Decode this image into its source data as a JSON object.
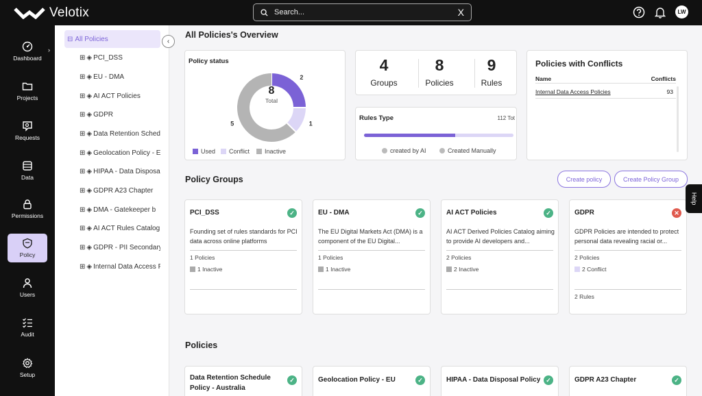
{
  "app": {
    "name": "Velotix"
  },
  "search": {
    "placeholder": "Search...",
    "clear": "X"
  },
  "user": {
    "initials": "LW"
  },
  "nav": [
    {
      "label": "Dashboard",
      "icon": "dashboard-icon"
    },
    {
      "label": "Projects",
      "icon": "folder-icon"
    },
    {
      "label": "Requests",
      "icon": "requests-icon"
    },
    {
      "label": "Data",
      "icon": "database-icon"
    },
    {
      "label": "Permissions",
      "icon": "lock-icon"
    },
    {
      "label": "Policy",
      "icon": "shield-icon",
      "active": true
    },
    {
      "label": "Users",
      "icon": "user-icon"
    },
    {
      "label": "Audit",
      "icon": "checklist-icon"
    },
    {
      "label": "Setup",
      "icon": "gear-icon"
    }
  ],
  "tree": {
    "root": "All Policies",
    "items": [
      "PCI_DSS",
      "EU - DMA",
      "AI ACT Policies",
      "GDPR",
      "Data Retention Schedule Policy - Australia",
      "Geolocation Policy - EU",
      "HIPAA - Data Disposal Policy",
      "GDPR A23 Chapter",
      "DMA - Gatekeeper b",
      "AI ACT Rules Catalog",
      "GDPR - PII Secondary",
      "Internal Data Access Policies"
    ]
  },
  "overview": {
    "title": "All Policies's Overview",
    "policy_status": {
      "title": "Policy status",
      "total": "8",
      "total_label": "Total",
      "used": 2,
      "conflict": 1,
      "inactive": 5,
      "used_label": "2",
      "conflict_label": "1",
      "inactive_label": "5",
      "legend": [
        "Used",
        "Conflict",
        "Inactive"
      ],
      "colors": {
        "used": "#7b62d6",
        "conflict": "#dcd6f6",
        "inactive": "#b4b4b4"
      }
    },
    "stats": [
      {
        "num": "4",
        "label": "Groups"
      },
      {
        "num": "8",
        "label": "Policies"
      },
      {
        "num": "9",
        "label": "Rules"
      }
    ],
    "rules_type": {
      "title": "Rules Type",
      "total": "112 Tot",
      "ai_fraction": 0.61,
      "legend": [
        "created by AI",
        "Created Manually"
      ]
    },
    "conflicts": {
      "title": "Policies with Conflicts",
      "col_name": "Name",
      "col_conflicts": "Conflicts",
      "rows": [
        {
          "name": "Internal Data Access Policies",
          "count": "93"
        }
      ]
    }
  },
  "groups": {
    "title": "Policy Groups",
    "create_policy": "Create policy",
    "create_group": "Create Policy Group",
    "cards": [
      {
        "title": "PCI_DSS",
        "desc": "Founding set of rules standards for PCI data across online platforms",
        "count": "1 Policies",
        "status": "1 Inactive",
        "status_type": "inactive",
        "rules": "",
        "ok": true
      },
      {
        "title": "EU - DMA",
        "desc": "The EU Digital Markets Act (DMA) is a component of the EU Digital...",
        "count": "1 Policies",
        "status": "1 Inactive",
        "status_type": "inactive",
        "rules": "",
        "ok": true
      },
      {
        "title": "AI ACT Policies",
        "desc": "AI ACT Derived Policies Catalog aiming to provide AI developers and...",
        "count": "2 Policies",
        "status": "2 Inactive",
        "status_type": "inactive",
        "rules": "",
        "ok": true
      },
      {
        "title": "GDPR",
        "desc": "GDPR Policies are intended to protect personal data revealing racial or...",
        "count": "2 Policies",
        "status": "2 Conflict",
        "status_type": "conflict",
        "rules": "2 Rules",
        "ok": false
      }
    ]
  },
  "policies": {
    "title": "Policies",
    "cards": [
      {
        "title": "Data Retention Schedule Policy - Australia",
        "ok": true
      },
      {
        "title": "Geolocation Policy - EU",
        "ok": true
      },
      {
        "title": "HIPAA - Data Disposal Policy",
        "ok": true
      },
      {
        "title": "GDPR A23 Chapter",
        "ok": true
      }
    ]
  },
  "help": {
    "label": "Help"
  }
}
